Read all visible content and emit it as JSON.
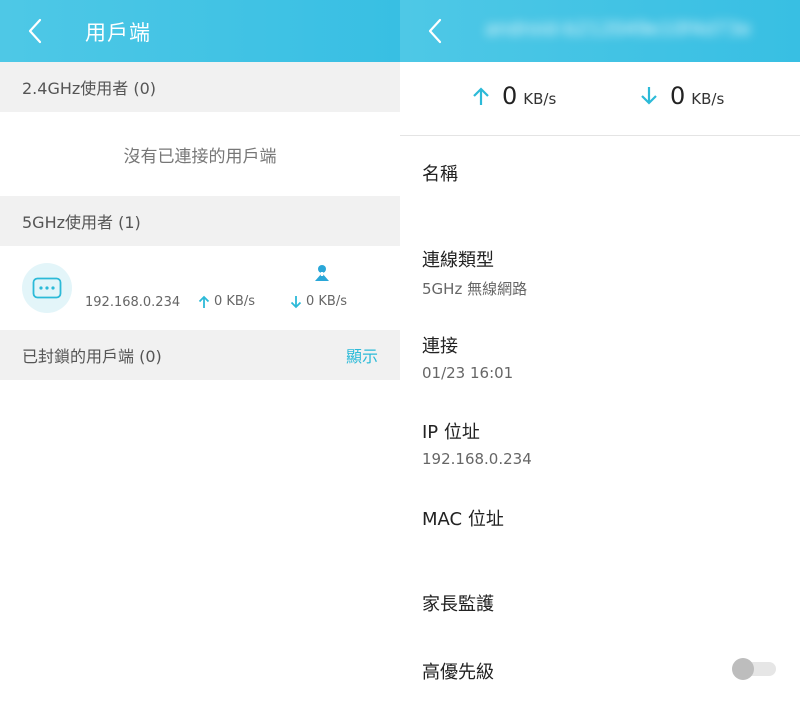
{
  "left": {
    "header": {
      "title": "用戶端"
    },
    "band24": {
      "title": "2.4GHz使用者 (0)",
      "empty_text": "沒有已連接的用戶端"
    },
    "band5": {
      "title": "5GHz使用者 (1)",
      "clients": [
        {
          "ip": "192.168.0.234",
          "upload": "0 KB/s",
          "download": "0 KB/s"
        }
      ]
    },
    "blocked": {
      "title": "已封鎖的用戶端 (0)",
      "show_link": "顯示"
    }
  },
  "right": {
    "header": {
      "device_id": "android-b212049e10f4d73e"
    },
    "speed": {
      "up_value": "0",
      "up_unit": "KB/s",
      "down_value": "0",
      "down_unit": "KB/s"
    },
    "fields": {
      "name_label": "名稱",
      "conn_type_label": "連線類型",
      "conn_type_value": "5GHz 無線網路",
      "connected_label": "連接",
      "connected_value": "01/23 16:01",
      "ip_label": "IP 位址",
      "ip_value": "192.168.0.234",
      "mac_label": "MAC 位址",
      "parental_label": "家長監護",
      "priority_label": "高優先級"
    },
    "priority_enabled": false
  },
  "colors": {
    "accent": "#38bfe3",
    "link": "#2cbad8",
    "section_bg": "#f1f1f1"
  },
  "icons": [
    "back-arrow-icon",
    "more-dots-icon",
    "upload-arrow-icon",
    "download-arrow-icon",
    "parent-user-icon"
  ]
}
